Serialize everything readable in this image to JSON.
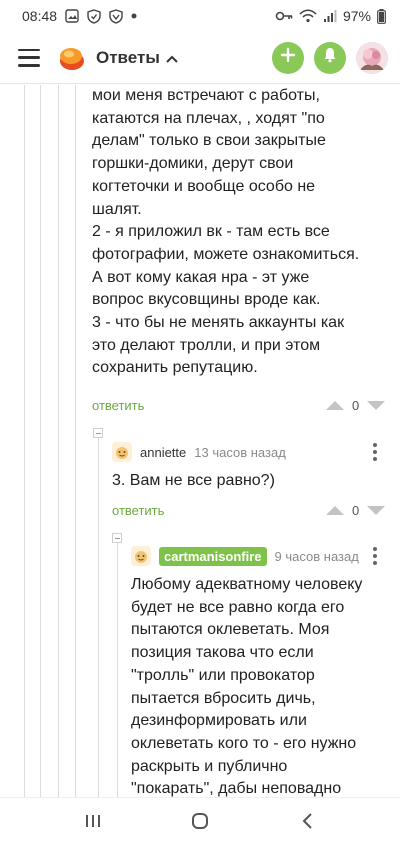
{
  "status_bar": {
    "time": "08:48",
    "battery": "97%",
    "icons": [
      "image-icon",
      "shield-check-icon",
      "shield-icon",
      "dot-icon",
      "key-icon",
      "wifi-icon",
      "signal-icon",
      "battery-icon"
    ]
  },
  "app_bar": {
    "title": "Ответы",
    "icons": [
      "menu-icon",
      "logo-icon",
      "chevron-up-icon",
      "plus-icon",
      "bell-icon",
      "avatar"
    ],
    "accent_color": "#8ac858"
  },
  "comments": [
    {
      "text_lines": [
        "мои меня встречают с работы,",
        "катаются на плечах, , ходят \"по",
        "делам\" только в свои закрытые",
        "горшки-домики, дерут свои",
        "когтеточки и вообще особо не",
        "шалят.",
        "2 - я приложил вк - там есть все",
        "фотографии, можете ознакомиться.",
        "А вот кому какая нра - эт уже",
        "вопрос вкусовщины вроде как.",
        "3 - что бы не менять аккаунты как",
        "это делают тролли, и при этом",
        "сохранить репутацию."
      ],
      "reply_label": "ответить",
      "score": "0"
    },
    {
      "author": "anniette",
      "time": "13 часов назад",
      "text": "3. Вам не все равно?)",
      "reply_label": "ответить",
      "score": "0"
    },
    {
      "author": "cartmanisonfire",
      "time": "9 часов назад",
      "text_lines": [
        "Любому адекватному человеку",
        "будет не все равно когда его",
        "пытаются оклеветать. Моя",
        "позиция такова что если",
        "\"тролль\" или провокатор",
        "пытается вбросить дичь,",
        "дезинформировать или",
        "оклеветать кого то - его нужно",
        "раскрыть и публично",
        "\"покарать\", дабы неповадно"
      ]
    }
  ],
  "nav_bar": {
    "icons": [
      "recents-icon",
      "home-icon",
      "back-icon"
    ]
  },
  "colors": {
    "link_green": "#6aa93f",
    "author_highlight": "#7ec24a"
  }
}
